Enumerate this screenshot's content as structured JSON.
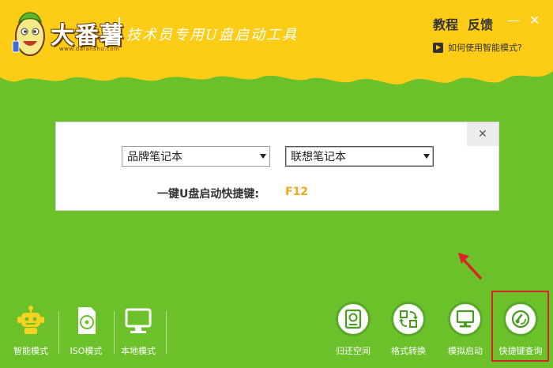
{
  "header": {
    "logo_title": "大番薯",
    "logo_url": "www.dafanshu.com",
    "slogan": "技术员专用U盘启动工具",
    "links": {
      "tutorial": "教程",
      "feedback": "反馈"
    },
    "window": {
      "minimize": "—",
      "close": "✕"
    },
    "help_text": "如何使用智能模式?"
  },
  "panel": {
    "brand_dropdown": "品牌笔记本",
    "model_dropdown": "联想笔记本",
    "hotkey_label": "一键U盘启动快捷键:",
    "hotkey_value": "F12",
    "close": "✕"
  },
  "modes": [
    {
      "label": "智能模式",
      "icon": "robot-icon"
    },
    {
      "label": "ISO模式",
      "icon": "disc-icon"
    },
    {
      "label": "本地模式",
      "icon": "monitor-icon"
    }
  ],
  "tools": [
    {
      "label": "归还空间",
      "icon": "hard-drive-icon"
    },
    {
      "label": "格式转换",
      "icon": "convert-icon"
    },
    {
      "label": "模拟启动",
      "icon": "computer-icon"
    },
    {
      "label": "快捷键查询",
      "icon": "hotkey-search-icon"
    }
  ],
  "colors": {
    "header_yellow": "#fccc16",
    "body_green": "#6cc12b",
    "hotkey_orange": "#f2a818",
    "highlight_red": "#d9222a"
  }
}
